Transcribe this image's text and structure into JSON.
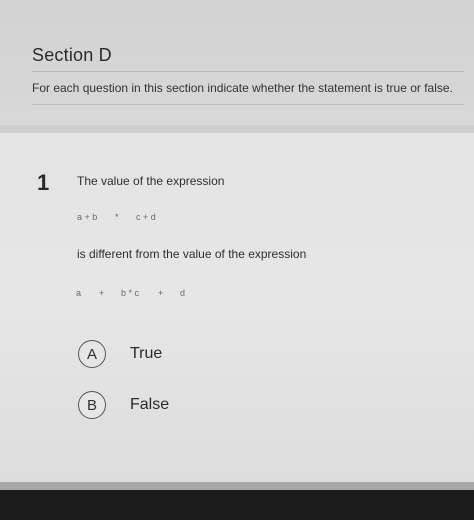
{
  "section": {
    "title": "Section D",
    "instructions": "For each question in this section indicate whether the statement is true or false."
  },
  "question": {
    "number": "1",
    "line1": "The value of the expression",
    "expr1": [
      "a + b",
      "*",
      "c + d"
    ],
    "line2": "is different from the value of the expression",
    "expr2": [
      "a",
      "+",
      "b * c",
      "+",
      "d"
    ]
  },
  "options": [
    {
      "letter": "A",
      "label": "True"
    },
    {
      "letter": "B",
      "label": "False"
    }
  ]
}
